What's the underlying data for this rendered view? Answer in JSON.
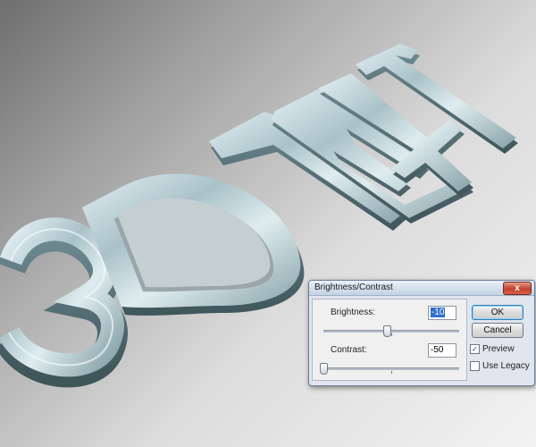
{
  "artwork": {
    "text": "3D TEXT",
    "colors": {
      "top_light": "#dceaf0",
      "top_mid": "#9fb7bd",
      "side_dark": "#5d7a80",
      "shadow": "#3f565b"
    }
  },
  "dialog": {
    "title": "Brightness/Contrast",
    "close_icon": "close-icon",
    "brightness": {
      "label": "Brightness:",
      "value": "-10",
      "min": -150,
      "max": 150,
      "current": -10
    },
    "contrast": {
      "label": "Contrast:",
      "value": "-50",
      "min": -50,
      "max": 100,
      "current": -50
    },
    "buttons": {
      "ok": "OK",
      "cancel": "Cancel"
    },
    "preview": {
      "label": "Preview",
      "checked": true
    },
    "legacy": {
      "label": "Use Legacy",
      "checked": false
    },
    "check_glyph": "✓",
    "close_glyph": "x"
  }
}
